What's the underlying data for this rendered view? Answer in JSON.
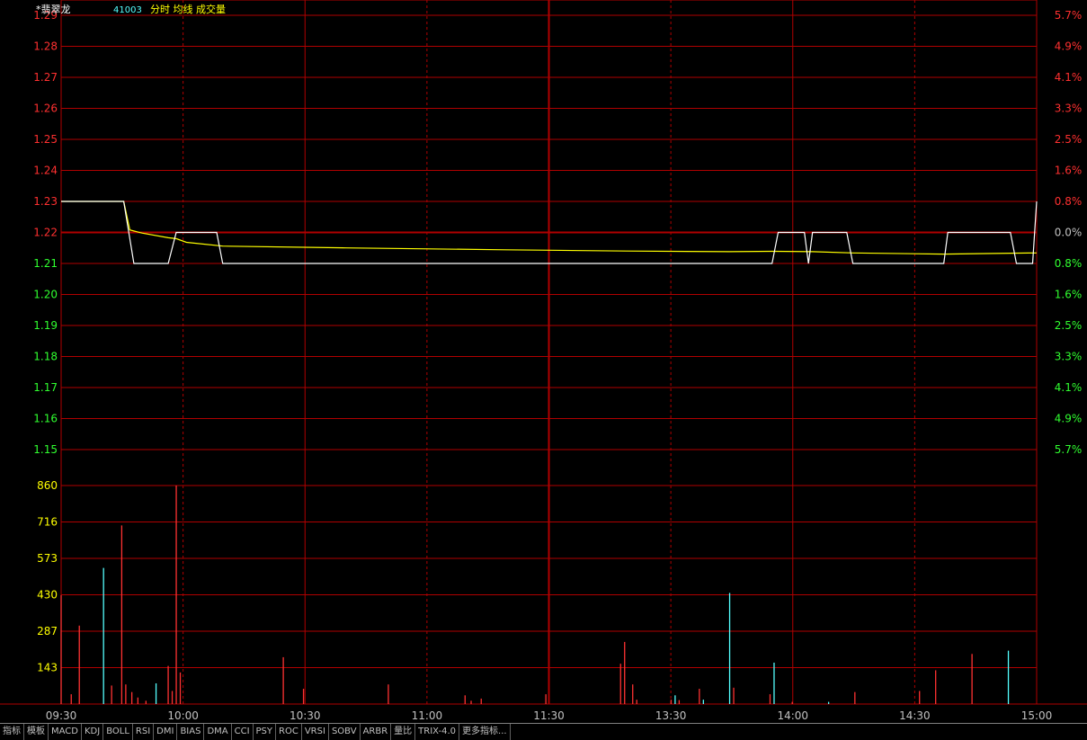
{
  "header": {
    "stock_name": "*翡翠龙",
    "stock_code": "41003",
    "indicators": "分时 均线 成交量"
  },
  "colors": {
    "grid": "#b00000",
    "up": "#ff3030",
    "down": "#30ff30",
    "price_line": "#ffffff",
    "avg_line": "#ffff00",
    "vol_up": "#ff3232",
    "vol_down": "#54ffff",
    "vol_label": "#ffff00"
  },
  "chart_data": {
    "type": "line",
    "ref_price": 1.22,
    "price_ticks": [
      "1.29",
      "1.28",
      "1.27",
      "1.26",
      "1.25",
      "1.24",
      "1.23",
      "1.22",
      "1.21",
      "1.20",
      "1.19",
      "1.18",
      "1.17",
      "1.16",
      "1.15"
    ],
    "pct_ticks": [
      "5.7%",
      "4.9%",
      "4.1%",
      "3.3%",
      "2.5%",
      "1.6%",
      "0.8%",
      "0.0%",
      "0.8%",
      "1.6%",
      "2.5%",
      "3.3%",
      "4.1%",
      "4.9%",
      "5.7%"
    ],
    "ylim": [
      1.15,
      1.29
    ],
    "time_labels": [
      "09:30",
      "10:00",
      "10:30",
      "11:00",
      "11:30",
      "13:30",
      "14:00",
      "14:30",
      "15:00"
    ],
    "price_series": [
      [
        0,
        1.23
      ],
      [
        31,
        1.23
      ],
      [
        36,
        1.21
      ],
      [
        53,
        1.21
      ],
      [
        57,
        1.22
      ],
      [
        77,
        1.22
      ],
      [
        80,
        1.21
      ],
      [
        141,
        1.21
      ],
      [
        170,
        1.21
      ],
      [
        220,
        1.21
      ],
      [
        280,
        1.21
      ],
      [
        331,
        1.21
      ],
      [
        352,
        1.21
      ],
      [
        355,
        1.22
      ],
      [
        368,
        1.22
      ],
      [
        370,
        1.21
      ],
      [
        372,
        1.22
      ],
      [
        389,
        1.22
      ],
      [
        392,
        1.21
      ],
      [
        421,
        1.21
      ],
      [
        437,
        1.21
      ],
      [
        439,
        1.22
      ],
      [
        470,
        1.22
      ],
      [
        473,
        1.21
      ],
      [
        481,
        1.21
      ],
      [
        483,
        1.23
      ]
    ],
    "avg_series": [
      [
        0,
        1.23
      ],
      [
        31,
        1.23
      ],
      [
        34,
        1.2208
      ],
      [
        40,
        1.2198
      ],
      [
        53,
        1.2183
      ],
      [
        57,
        1.218
      ],
      [
        62,
        1.2168
      ],
      [
        80,
        1.2156
      ],
      [
        141,
        1.215
      ],
      [
        220,
        1.2144
      ],
      [
        280,
        1.214
      ],
      [
        331,
        1.2138
      ],
      [
        352,
        1.2139
      ],
      [
        372,
        1.2138
      ],
      [
        392,
        1.2134
      ],
      [
        437,
        1.213
      ],
      [
        470,
        1.2133
      ],
      [
        483,
        1.2134
      ]
    ],
    "volume_ticks": [
      "860",
      "716",
      "573",
      "430",
      "287",
      "143"
    ],
    "volume_max": 1003,
    "volume_bars": [
      {
        "t": 0,
        "v": 500,
        "c": "up"
      },
      {
        "t": 5,
        "v": 45,
        "c": "up"
      },
      {
        "t": 9,
        "v": 360,
        "c": "up"
      },
      {
        "t": 21,
        "v": 625,
        "c": "down"
      },
      {
        "t": 25,
        "v": 85,
        "c": "up"
      },
      {
        "t": 30,
        "v": 820,
        "c": "up"
      },
      {
        "t": 32,
        "v": 90,
        "c": "up"
      },
      {
        "t": 35,
        "v": 55,
        "c": "up"
      },
      {
        "t": 38,
        "v": 30,
        "c": "up"
      },
      {
        "t": 42,
        "v": 15,
        "c": "up"
      },
      {
        "t": 47,
        "v": 95,
        "c": "down"
      },
      {
        "t": 53,
        "v": 175,
        "c": "up"
      },
      {
        "t": 55,
        "v": 60,
        "c": "up"
      },
      {
        "t": 57,
        "v": 1003,
        "c": "up"
      },
      {
        "t": 59,
        "v": 145,
        "c": "up"
      },
      {
        "t": 110,
        "v": 215,
        "c": "up"
      },
      {
        "t": 120,
        "v": 70,
        "c": "up"
      },
      {
        "t": 162,
        "v": 90,
        "c": "up"
      },
      {
        "t": 200,
        "v": 40,
        "c": "up"
      },
      {
        "t": 203,
        "v": 15,
        "c": "up"
      },
      {
        "t": 208,
        "v": 25,
        "c": "up"
      },
      {
        "t": 240,
        "v": 45,
        "c": "up"
      },
      {
        "t": 277,
        "v": 185,
        "c": "up"
      },
      {
        "t": 279,
        "v": 285,
        "c": "up"
      },
      {
        "t": 283,
        "v": 90,
        "c": "up"
      },
      {
        "t": 285,
        "v": 20,
        "c": "up"
      },
      {
        "t": 302,
        "v": 20,
        "c": "up"
      },
      {
        "t": 304,
        "v": 40,
        "c": "down"
      },
      {
        "t": 306,
        "v": 18,
        "c": "up"
      },
      {
        "t": 316,
        "v": 70,
        "c": "up"
      },
      {
        "t": 318,
        "v": 20,
        "c": "down"
      },
      {
        "t": 331,
        "v": 510,
        "c": "down"
      },
      {
        "t": 333,
        "v": 75,
        "c": "up"
      },
      {
        "t": 351,
        "v": 45,
        "c": "up"
      },
      {
        "t": 353,
        "v": 190,
        "c": "down"
      },
      {
        "t": 362,
        "v": 10,
        "c": "up"
      },
      {
        "t": 380,
        "v": 10,
        "c": "down"
      },
      {
        "t": 393,
        "v": 55,
        "c": "up"
      },
      {
        "t": 425,
        "v": 60,
        "c": "up"
      },
      {
        "t": 433,
        "v": 155,
        "c": "up"
      },
      {
        "t": 451,
        "v": 230,
        "c": "up"
      },
      {
        "t": 469,
        "v": 245,
        "c": "down"
      }
    ]
  },
  "bottom_tabs": [
    "指标",
    "模板",
    "MACD",
    "KDJ",
    "BOLL",
    "RSI",
    "DMI",
    "BIAS",
    "DMA",
    "CCI",
    "PSY",
    "ROC",
    "VRSI",
    "SOBV",
    "ARBR",
    "量比",
    "TRIX-4.0",
    "更多指标..."
  ]
}
